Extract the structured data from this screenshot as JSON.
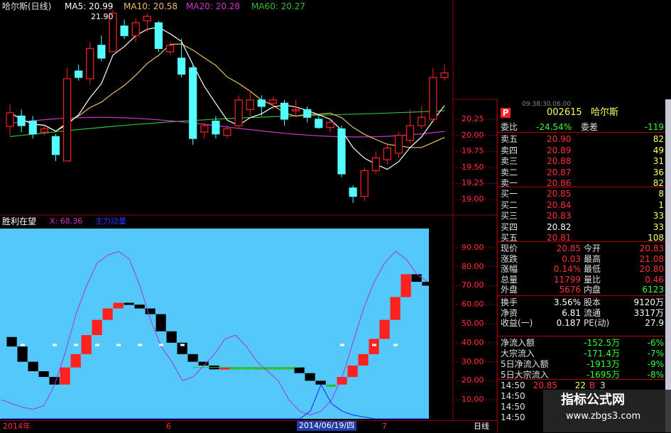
{
  "colors": {
    "bg": "#000000",
    "panel_bg": "#0a0a0a",
    "up": "#ff2020",
    "down": "#54ffff",
    "ind_bg": "#54c8f8",
    "ma5": "#ffffff",
    "ma10": "#e8c060",
    "ma20": "#cc33cc",
    "ma60": "#33bb33",
    "text_red": "#ff3030",
    "text_green": "#33ff33",
    "grid": "#8a0000",
    "label": "#ff3030"
  },
  "header": {
    "name": "哈尔斯(日线)",
    "ma5": "MA5: 20.99",
    "ma10": "MA10: 20.58",
    "ma20": "MA20: 20.28",
    "ma60": "MA60: 20.27",
    "high_marker": "21.90"
  },
  "indicator": {
    "name": "胜利在望",
    "x_val": "X: 68.36",
    "tag": "主力动量"
  },
  "price_axis": [
    "20.25",
    "20.00",
    "19.75",
    "19.50",
    "19.25",
    "19.00"
  ],
  "ind_axis": [
    "90.00",
    "80.00",
    "70.00",
    "60.00",
    "50.00",
    "40.00",
    "30.00",
    "20.00",
    "10.00"
  ],
  "x_axis": {
    "start": "2014年",
    "mid": "6",
    "date": "2014/06/19/四",
    "end": "7",
    "period": "日线"
  },
  "quote": {
    "time_partial": "09:38:30.06.00",
    "p_icon": "P",
    "code": "002615",
    "name": "哈尔斯",
    "weibi_label": "委比",
    "weibi": "-24.54%",
    "weicha_label": "委差",
    "weicha": "-119",
    "asks": [
      {
        "label": "卖五",
        "price": "20.90",
        "vol": "82"
      },
      {
        "label": "卖四",
        "price": "20.89",
        "vol": "49"
      },
      {
        "label": "卖三",
        "price": "20.88",
        "vol": "31"
      },
      {
        "label": "卖二",
        "price": "20.87",
        "vol": "36"
      },
      {
        "label": "卖一",
        "price": "20.86",
        "vol": "82"
      }
    ],
    "bids": [
      {
        "label": "买一",
        "price": "20.85",
        "vol": "8"
      },
      {
        "label": "买二",
        "price": "20.84",
        "vol": "1"
      },
      {
        "label": "买三",
        "price": "20.83",
        "vol": "33"
      },
      {
        "label": "买四",
        "price": "20.82",
        "vol": "33"
      },
      {
        "label": "买五",
        "price": "20.81",
        "vol": "108"
      }
    ],
    "stats": [
      {
        "l1": "现价",
        "v1": "20.85",
        "l2": "今开",
        "v2": "20.83"
      },
      {
        "l1": "涨跌",
        "v1": "0.03",
        "l2": "最高",
        "v2": "21.08"
      },
      {
        "l1": "涨幅",
        "v1": "0.14%",
        "l2": "最低",
        "v2": "20.80"
      },
      {
        "l1": "总量",
        "v1": "11799",
        "l2": "量比",
        "v2": "0.46"
      },
      {
        "l1": "外盘",
        "v1": "5676",
        "l2": "内盘",
        "v2": "6123"
      }
    ],
    "fund": [
      {
        "l1": "换手",
        "v1": "3.56%",
        "l2": "股本",
        "v2": "9120万"
      },
      {
        "l1": "净资",
        "v1": "6.81",
        "l2": "流通",
        "v2": "3317万"
      },
      {
        "l1": "收益(一)",
        "v1": "0.187",
        "l2": "PE(动)",
        "v2": "27.9"
      }
    ],
    "flows": [
      {
        "label": "净流入额",
        "value": "-152.5万",
        "pct": "-6%"
      },
      {
        "label": "大宗流入",
        "value": "-171.4万",
        "pct": "-7%"
      },
      {
        "label": "5日净流入额",
        "value": "-1913万",
        "pct": "-9%"
      },
      {
        "label": "5日大宗流入",
        "value": "-1695万",
        "pct": "-8%"
      }
    ],
    "ticks": [
      {
        "time": "14:50",
        "price": "20.85",
        "vol": "22",
        "side": "B",
        "n": "3"
      },
      {
        "time": "14:50",
        "price": "",
        "vol": "",
        "side": "",
        "n": ""
      },
      {
        "time": "14:50",
        "price": "",
        "vol": "",
        "side": "",
        "n": ""
      },
      {
        "time": "14:50",
        "price": "",
        "vol": "",
        "side": "",
        "n": ""
      }
    ]
  },
  "watermark": {
    "title": "指标公式网",
    "url": "www.zbgs3.com"
  },
  "chart_data": {
    "type": "candlestick",
    "candles": [
      {
        "o": 20.14,
        "c": 20.35,
        "h": 20.48,
        "l": 20.0
      },
      {
        "o": 20.3,
        "c": 20.15,
        "h": 20.4,
        "l": 20.05
      },
      {
        "o": 20.22,
        "c": 20.02,
        "h": 20.3,
        "l": 19.95
      },
      {
        "o": 20.05,
        "c": 20.1,
        "h": 20.15,
        "l": 20.0
      },
      {
        "o": 19.98,
        "c": 19.7,
        "h": 20.02,
        "l": 19.6
      },
      {
        "o": 19.6,
        "c": 20.88,
        "h": 21.05,
        "l": 19.6
      },
      {
        "o": 21.0,
        "c": 20.9,
        "h": 21.1,
        "l": 20.85
      },
      {
        "o": 20.88,
        "c": 21.35,
        "h": 21.45,
        "l": 20.8
      },
      {
        "o": 21.4,
        "c": 21.2,
        "h": 21.55,
        "l": 21.15
      },
      {
        "o": 21.3,
        "c": 21.9,
        "h": 21.95,
        "l": 21.3
      },
      {
        "o": 21.7,
        "c": 21.55,
        "h": 21.8,
        "l": 21.5
      },
      {
        "o": 21.55,
        "c": 21.75,
        "h": 21.82,
        "l": 21.45
      },
      {
        "o": 21.78,
        "c": 21.85,
        "h": 21.9,
        "l": 21.6
      },
      {
        "o": 21.75,
        "c": 21.35,
        "h": 21.78,
        "l": 21.3
      },
      {
        "o": 21.3,
        "c": 21.4,
        "h": 21.45,
        "l": 21.25
      },
      {
        "o": 21.2,
        "c": 20.95,
        "h": 21.5,
        "l": 20.9
      },
      {
        "o": 21.05,
        "c": 19.95,
        "h": 21.1,
        "l": 19.85
      },
      {
        "o": 20.05,
        "c": 20.15,
        "h": 20.2,
        "l": 19.95
      },
      {
        "o": 20.22,
        "c": 20.02,
        "h": 20.3,
        "l": 19.95
      },
      {
        "o": 20.0,
        "c": 20.1,
        "h": 20.15,
        "l": 19.95
      },
      {
        "o": 20.15,
        "c": 20.55,
        "h": 20.62,
        "l": 20.1
      },
      {
        "o": 20.4,
        "c": 20.55,
        "h": 20.7,
        "l": 20.3
      },
      {
        "o": 20.55,
        "c": 20.45,
        "h": 20.62,
        "l": 20.3
      },
      {
        "o": 20.5,
        "c": 20.55,
        "h": 20.6,
        "l": 20.4
      },
      {
        "o": 20.5,
        "c": 20.25,
        "h": 20.55,
        "l": 20.15
      },
      {
        "o": 20.38,
        "c": 20.4,
        "h": 20.55,
        "l": 20.3
      },
      {
        "o": 20.4,
        "c": 20.28,
        "h": 20.45,
        "l": 20.2
      },
      {
        "o": 20.25,
        "c": 20.12,
        "h": 20.32,
        "l": 20.1
      },
      {
        "o": 20.12,
        "c": 20.2,
        "h": 20.25,
        "l": 20.05
      },
      {
        "o": 20.1,
        "c": 19.4,
        "h": 20.15,
        "l": 19.35
      },
      {
        "o": 19.18,
        "c": 19.05,
        "h": 19.22,
        "l": 18.95
      },
      {
        "o": 19.05,
        "c": 19.45,
        "h": 19.5,
        "l": 18.98
      },
      {
        "o": 19.45,
        "c": 19.65,
        "h": 19.75,
        "l": 19.4
      },
      {
        "o": 19.62,
        "c": 19.8,
        "h": 19.88,
        "l": 19.55
      },
      {
        "o": 19.72,
        "c": 20.0,
        "h": 20.05,
        "l": 19.65
      },
      {
        "o": 19.92,
        "c": 20.15,
        "h": 20.4,
        "l": 19.88
      },
      {
        "o": 20.15,
        "c": 20.28,
        "h": 20.45,
        "l": 20.1
      },
      {
        "o": 20.25,
        "c": 20.9,
        "h": 21.05,
        "l": 20.2
      },
      {
        "o": 20.9,
        "c": 20.97,
        "h": 21.1,
        "l": 20.85
      }
    ],
    "indicator_values": [
      43,
      38,
      30,
      25,
      22,
      18,
      27,
      34,
      44,
      52,
      58,
      61,
      60,
      58,
      55,
      46,
      40,
      34,
      30,
      28,
      26,
      27,
      27,
      27,
      27,
      27,
      27,
      27,
      24,
      20,
      18,
      18,
      22,
      28,
      34,
      42,
      52,
      64,
      76,
      72,
      70
    ]
  }
}
